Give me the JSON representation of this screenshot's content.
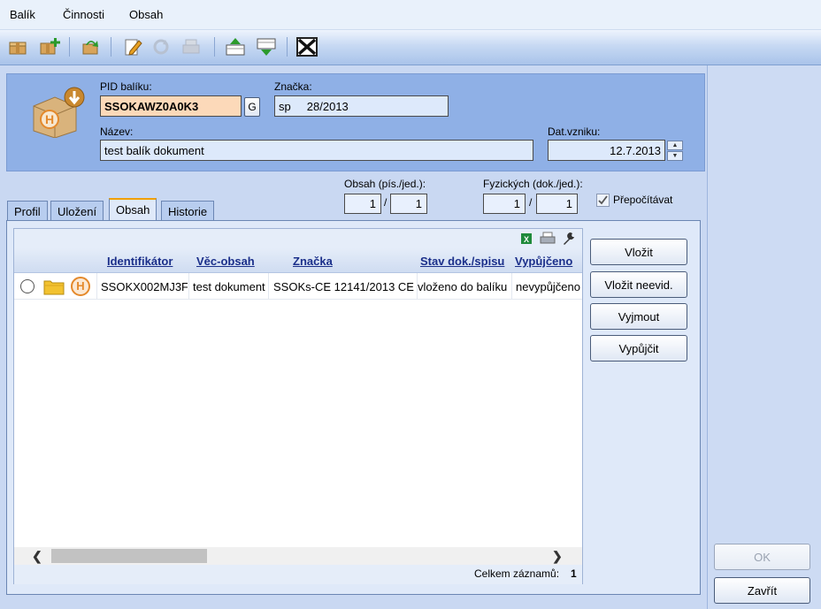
{
  "menu": {
    "items": [
      "Balík",
      "Činnosti",
      "Obsah"
    ]
  },
  "toolbar": {
    "icons": [
      "package-icon",
      "add-package-icon",
      "refresh-icon",
      "edit-icon",
      "sync-icon",
      "print-icon",
      "move-up-icon",
      "move-down-icon",
      "close-icon"
    ]
  },
  "header": {
    "pid_label": "PID balíku:",
    "pid_value": "SSOKAWZ0A0K3",
    "g_button": "G",
    "znacka_label": "Značka:",
    "znacka_value": "sp     28/2013",
    "nazev_label": "Název:",
    "nazev_value": "test balík dokument",
    "dat_label": "Dat.vzniku:",
    "dat_value": "12.7.2013"
  },
  "counts": {
    "obsah_label": "Obsah (pís./jed.):",
    "obsah_a": "1",
    "obsah_b": "1",
    "fyz_label": "Fyzických (dok./jed.):",
    "fyz_a": "1",
    "fyz_b": "1",
    "slash": "/",
    "prepocitavat_label": "Přepočítávat",
    "prepocitavat_checked": true
  },
  "tabs": [
    {
      "label": "Profil",
      "active": false
    },
    {
      "label": "Uložení",
      "active": false
    },
    {
      "label": "Obsah",
      "active": true
    },
    {
      "label": "Historie",
      "active": false
    }
  ],
  "grid": {
    "columns": [
      "Identifikátor",
      "Věc-obsah",
      "Značka",
      "Stav dok./spisu",
      "Vypůjčeno"
    ],
    "rows": [
      {
        "identifikator": "SSOKX002MJ3F",
        "vec": "test dokument",
        "znacka": "SSOKs-CE 12141/2013 CE",
        "stav": "vloženo do balíku",
        "vypujceno": "nevypůjčeno",
        "icon_letter": "H"
      }
    ],
    "footer_label": "Celkem záznamů:",
    "footer_count": "1"
  },
  "actions": {
    "vlozit": "Vložit",
    "vlozit_neevid": "Vložit neevid.",
    "vyjmout": "Vyjmout",
    "vypujcit": "Vypůjčit"
  },
  "dialog": {
    "ok": "OK",
    "zavrit": "Zavřít"
  },
  "colors": {
    "header_bg": "#8fb0e6",
    "pid_highlight": "#fcd9b9",
    "active_tab_accent": "#f0a000"
  }
}
